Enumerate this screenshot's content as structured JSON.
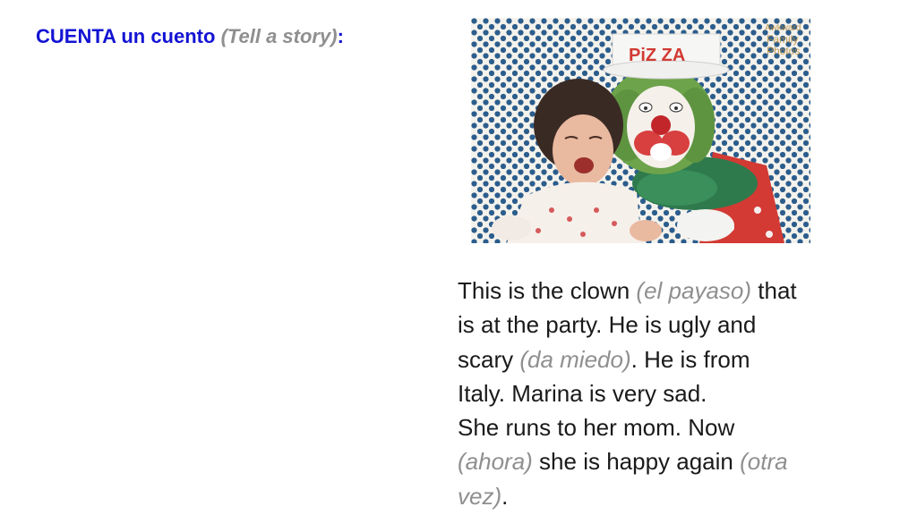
{
  "title": {
    "main": "CUENTA un cuento",
    "gloss": "(Tell a story)",
    "colon": ":"
  },
  "photo": {
    "hat_text": "PiZ ZA",
    "watermark": [
      "Awkward",
      "Family",
      "Photos"
    ]
  },
  "story": {
    "line1_a": "This is the clown ",
    "line1_gloss": "(el payaso)",
    "line1_b": " that",
    "line2": "is at the party. He is ugly and",
    "line3_a": "scary ",
    "line3_gloss": "(da miedo)",
    "line3_b": ". He is from",
    "line4": "Italy. Marina is very sad.",
    "line5": "She runs to her mom.  Now",
    "line6_gloss": "(ahora)",
    "line6_a": " she is happy again ",
    "line6_gloss2": "(otra",
    "line7_gloss": "vez)",
    "line7_b": "."
  },
  "colors": {
    "title": "#1313d4",
    "gloss": "#8f8f8f",
    "body": "#1a1a1a"
  }
}
